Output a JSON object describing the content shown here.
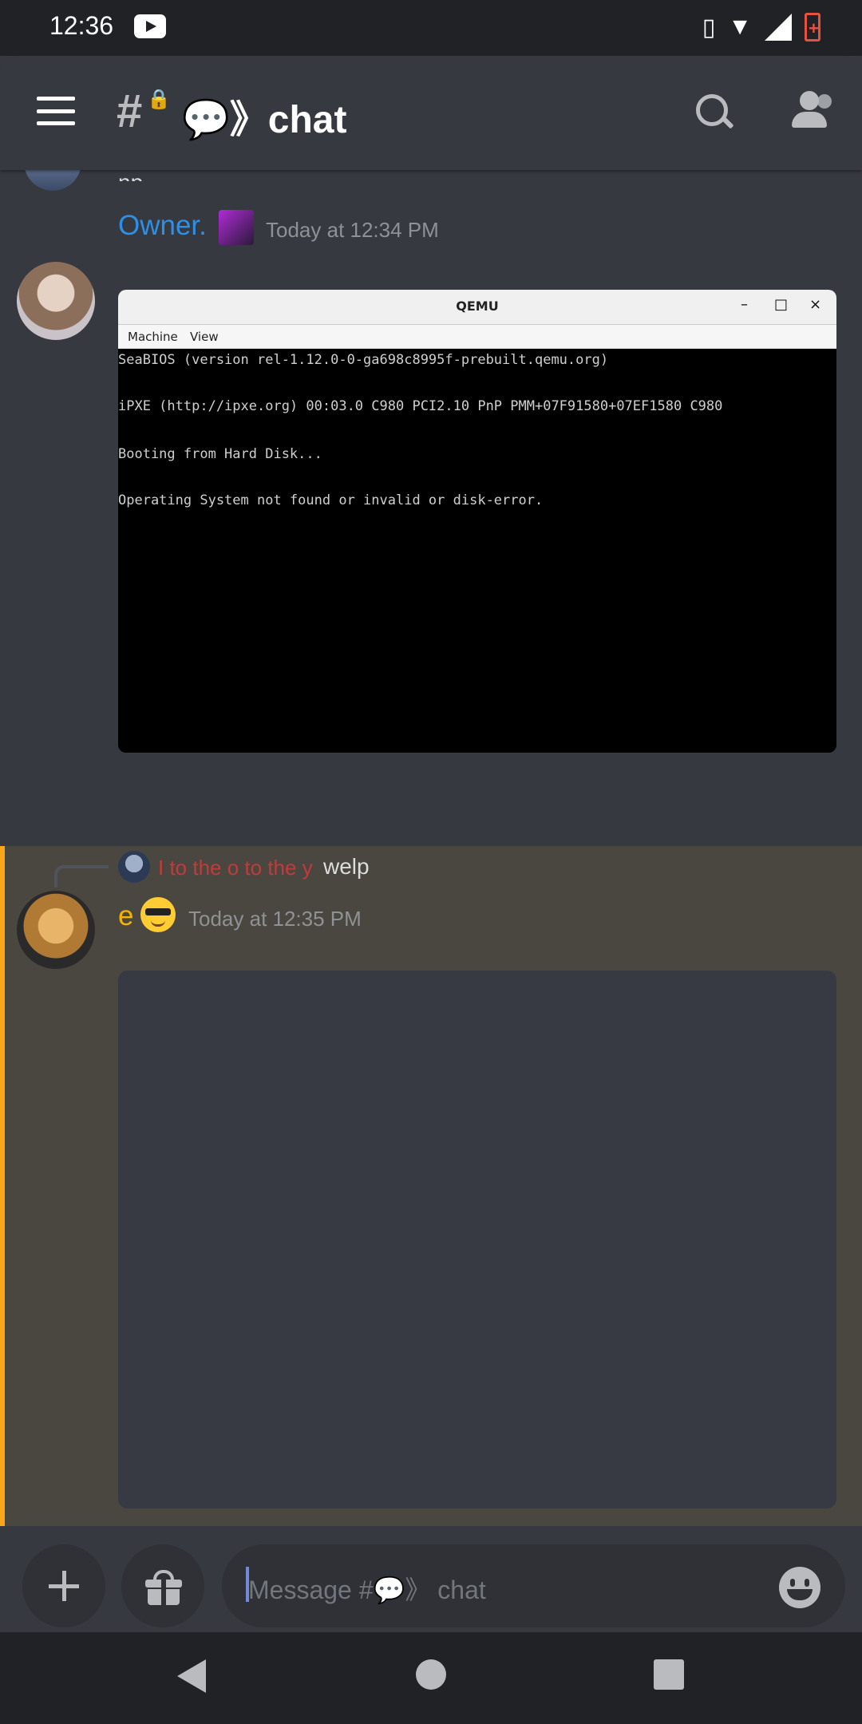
{
  "status_bar": {
    "time": "12:36"
  },
  "header": {
    "channel_title": "💬》chat",
    "channel_symbol": "#"
  },
  "messages": {
    "partial_text": "np",
    "owner": {
      "username": "Owner.",
      "timestamp": "Today at 12:34 PM",
      "attachment": {
        "window_title": "QEMU",
        "menu": [
          "Machine",
          "View"
        ],
        "controls": [
          "–",
          "□",
          "×"
        ],
        "lines": [
          "SeaBIOS (version rel-1.12.0-0-ga698c8995f-prebuilt.qemu.org)",
          "iPXE (http://ipxe.org) 00:03.0 C980 PCI2.10 PnP PMM+07F91580+07EF1580 C980",
          "Booting from Hard Disk...",
          "Operating System not found or invalid or disk-error."
        ]
      }
    },
    "e": {
      "reply_to_name": "I to the o to the y",
      "reply_to_text": "welp",
      "username": "e",
      "timestamp": "Today at 12:35 PM"
    }
  },
  "composer": {
    "placeholder": "Message #💬》 chat"
  },
  "colors": {
    "accent": "#faa61a",
    "owner_name": "#2d8fe6",
    "e_name": "#f4b400",
    "reply_name": "#c23a3a"
  }
}
